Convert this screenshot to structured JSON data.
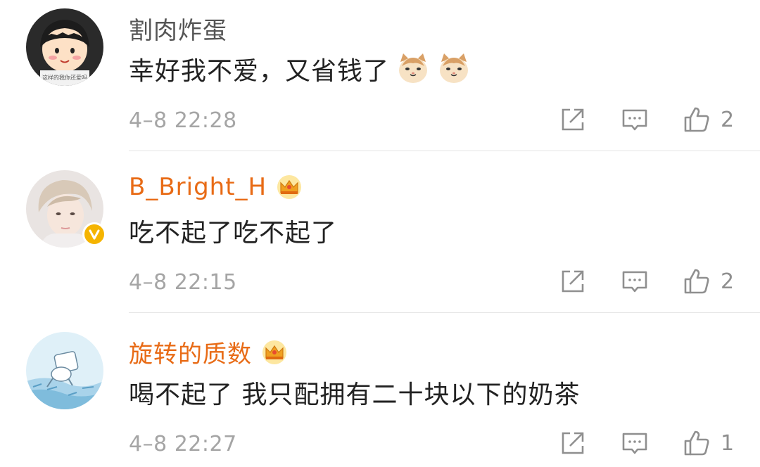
{
  "comments": [
    {
      "username": "割肉炸蛋",
      "vip": false,
      "verified": false,
      "text": "幸好我不爱，又省钱了",
      "emoji": [
        "cat-emoji",
        "cat-emoji"
      ],
      "time": "4–8 22:28",
      "likes": "2",
      "avatar_text": "这样的我你还爱吗"
    },
    {
      "username": "B_Bright_H",
      "vip": true,
      "verified": true,
      "text": "吃不起了吃不起了",
      "emoji": [],
      "time": "4–8 22:15",
      "likes": "2"
    },
    {
      "username": "旋转的质数",
      "vip": true,
      "verified": false,
      "text": "喝不起了 我只配拥有二十块以下的奶茶",
      "emoji": [],
      "time": "4–8 22:27",
      "likes": "1"
    }
  ],
  "icons": {
    "share": "share-icon",
    "reply": "reply-icon",
    "like": "thumbs-up-icon",
    "vip": "crown-icon",
    "verified": "verified-v-icon"
  },
  "colors": {
    "vip_name": "#e86b16",
    "plain_name": "#555555",
    "meta": "#a5a5a5",
    "badge": "#f5b400"
  }
}
